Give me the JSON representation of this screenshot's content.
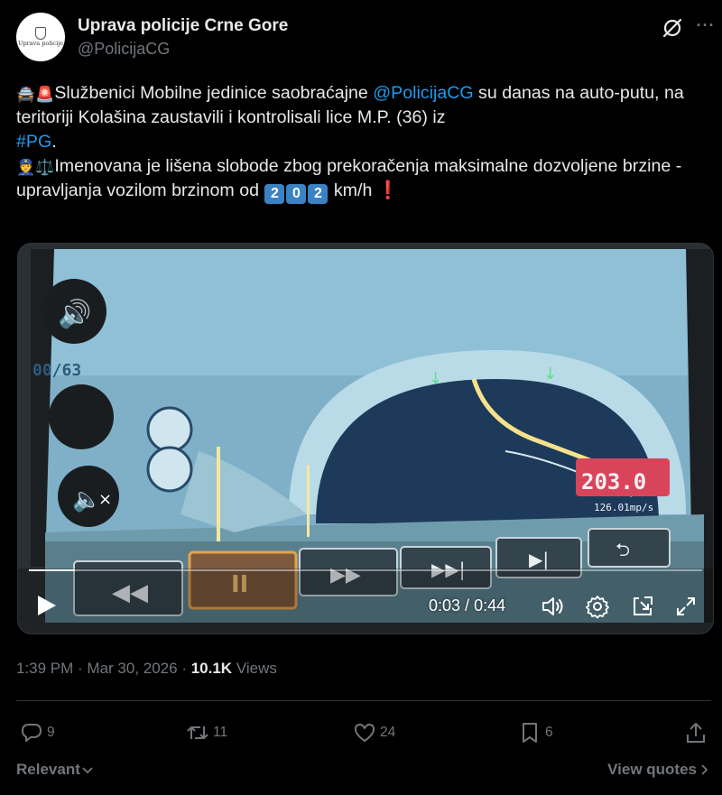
{
  "author": {
    "display_name": "Uprava policije Crne Gore",
    "handle": "@PolicijaCG",
    "avatar_logo_text": "Uprava policije"
  },
  "tweet": {
    "emoji_1": "🚔",
    "emoji_2": "🚨",
    "part1": "Službenici Mobilne jedinice saobraćajne ",
    "mention": "@PolicijaCG",
    "part2": " su danas na auto-putu, na teritoriji Kolašina zaustavili i kontrolisali lice M.P. (36) iz ",
    "hashtag": "#PG",
    "part3": ".",
    "emoji_3": "👮",
    "emoji_4": "⚖️",
    "part4": "Imenovana je lišena slobode zbog prekoračenja maksimalne dozvoljene brzine - upravljanja vozilom brzinom od ",
    "speed_digits": [
      "2",
      "0",
      "2"
    ],
    "part5": " km/h",
    "exclamation": "❗"
  },
  "video": {
    "current_time": "0:03",
    "separator": " / ",
    "duration": "0:44",
    "progress": 0.068,
    "screen_speed_reading": "203.0",
    "screen_speed_secondary": "126.01mp/s",
    "screen_counter": "00/63"
  },
  "meta": {
    "time": "1:39 PM",
    "dot": " · ",
    "date": "Mar 30, 2026",
    "dot2": " · ",
    "views_count": "10.1K",
    "views_label": " Views"
  },
  "actions": {
    "replies": "9",
    "reposts": "11",
    "likes": "24",
    "bookmarks": "6"
  },
  "footer": {
    "sort_label": "Relevant",
    "view_quotes_label": "View quotes"
  },
  "colors": {
    "background": "#000000",
    "text": "#e7e9ea",
    "muted": "#71767b",
    "link": "#1d9bf0",
    "keycap": "#3b82c4"
  }
}
